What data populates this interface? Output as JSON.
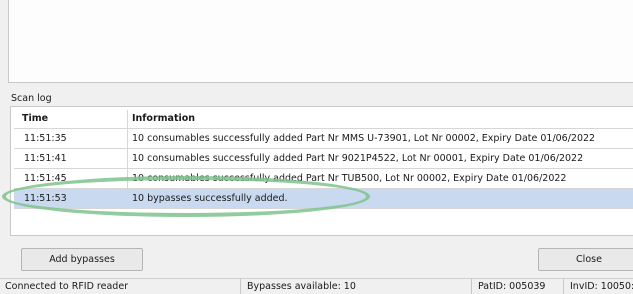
{
  "scan_log": {
    "label": "Scan log",
    "columns": {
      "time": "Time",
      "information": "Information"
    },
    "rows": [
      {
        "time": "11:51:35",
        "info": "10 consumables successfully added Part Nr MMS U-73901, Lot Nr 00002, Expiry Date 01/06/2022",
        "selected": false
      },
      {
        "time": "11:51:41",
        "info": "10 consumables successfully added Part Nr 9021P4522, Lot Nr 00001, Expiry Date 01/06/2022",
        "selected": false
      },
      {
        "time": "11:51:45",
        "info": "10 consumables successfully added Part Nr TUB500, Lot Nr 00002, Expiry Date 01/06/2022",
        "selected": false
      },
      {
        "time": "11:51:53",
        "info": "10 bypasses successfully added.",
        "selected": true
      }
    ]
  },
  "buttons": {
    "add_bypasses": "Add bypasses",
    "close": "Close"
  },
  "status_bar": {
    "connection": "Connected to RFID reader",
    "bypasses": "Bypasses available: 10",
    "pat_id": "PatID: 005039",
    "inv_id": "InvID: 10050:"
  },
  "colors": {
    "selected_row": "#c9d9ef",
    "highlight_ellipse": "#7cc38c"
  }
}
